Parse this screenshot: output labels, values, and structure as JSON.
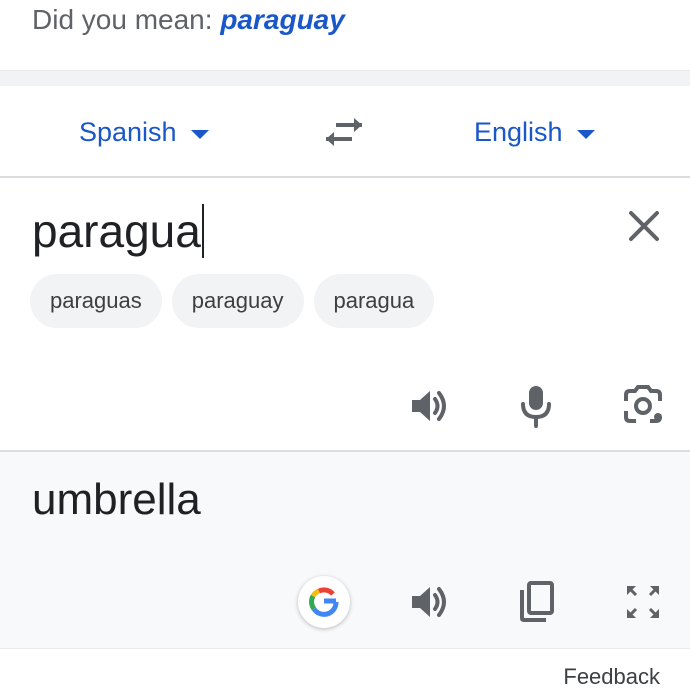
{
  "suggestion": {
    "prefix": "Did you mean: ",
    "term": "paraguay"
  },
  "languages": {
    "source": "Spanish",
    "target": "English",
    "swap_icon": "swap-horiz-icon"
  },
  "input": {
    "text": "paragua",
    "clear_icon": "close-icon",
    "chips": [
      "paraguas",
      "paraguay",
      "paragua"
    ],
    "actions": [
      "volume-up-icon",
      "mic-icon",
      "camera-lens-icon"
    ]
  },
  "output": {
    "text": "umbrella",
    "actions": [
      "google-g-icon",
      "volume-up-icon",
      "copy-icon",
      "fullscreen-icon"
    ]
  },
  "footer": {
    "feedback": "Feedback"
  },
  "colors": {
    "accent": "#1a57c8",
    "icon": "#5f6368",
    "output_bg": "#f8f9fa",
    "chip_bg": "#f1f3f4"
  }
}
